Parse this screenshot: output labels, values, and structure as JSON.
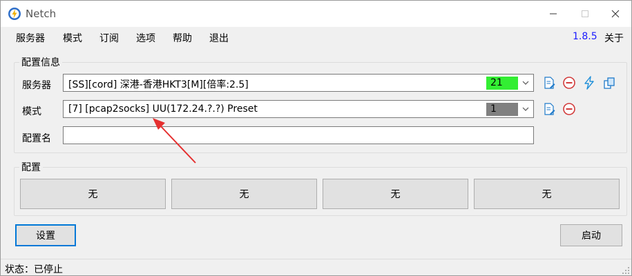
{
  "window": {
    "title": "Netch"
  },
  "menu": {
    "items": [
      "服务器",
      "模式",
      "订阅",
      "选项",
      "帮助",
      "退出"
    ],
    "version": "1.8.5",
    "about": "关于"
  },
  "config_info": {
    "title": "配置信息",
    "server_label": "服务器",
    "server_value": "[SS][cord] 深港-香港HKT3[M][倍率:2.5]",
    "server_badge": "21",
    "server_badge_color": "#33ee33",
    "mode_label": "模式",
    "mode_value": "[7] [pcap2socks] UU(172.24.?.?) Preset",
    "mode_badge": "1",
    "mode_badge_color": "#808080",
    "profile_label": "配置名",
    "profile_value": ""
  },
  "profiles": {
    "title": "配置",
    "buttons": [
      "无",
      "无",
      "无",
      "无"
    ]
  },
  "actions": {
    "settings": "设置",
    "start": "启动"
  },
  "status": {
    "text": "状态：已停止"
  },
  "colors": {
    "accent": "#0078d7",
    "version_link": "#1a1aff",
    "annotation_arrow": "#e53030"
  },
  "icons": [
    "netch-app-icon",
    "edit-icon",
    "delete-icon",
    "speed-test-icon",
    "copy-icon",
    "chevron-down-icon",
    "annotation-arrow"
  ]
}
